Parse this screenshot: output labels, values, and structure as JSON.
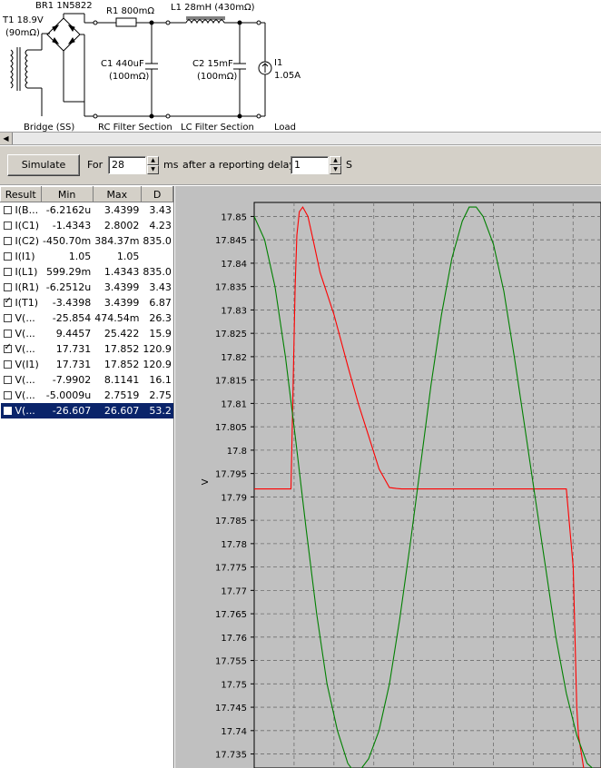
{
  "schematic": {
    "transformer": {
      "line1": "T1 18.9V",
      "line2": "(90mΩ)"
    },
    "bridge": {
      "label": "BR1 1N5822",
      "section": "Bridge (SS)"
    },
    "r1": {
      "label": "R1 800mΩ"
    },
    "l1": {
      "label": "L1 28mH (430mΩ)"
    },
    "c1": {
      "line1": "C1 440uF",
      "line2": "(100mΩ)"
    },
    "c2": {
      "line1": "C2 15mF",
      "line2": "(100mΩ)"
    },
    "i1": {
      "line1": "I1",
      "line2": "1.05A"
    },
    "sections": {
      "rc": "RC Filter Section",
      "lc": "LC Filter Section",
      "load": "Load"
    }
  },
  "scroll": {
    "left_arrow": "◀"
  },
  "toolbar": {
    "simulate_label": "Simulate",
    "for_label": "For",
    "duration_value": "28",
    "duration_unit": "ms",
    "delay_label": "after a reporting delay of",
    "delay_value": "1",
    "delay_unit": "S"
  },
  "results": {
    "columns": [
      "Result",
      "Min",
      "Max",
      "D"
    ],
    "rows": [
      {
        "name": "I(B...",
        "min": "-6.2162u",
        "max": "3.4399",
        "d": "3.43",
        "checked": false,
        "selected": false
      },
      {
        "name": "I(C1)",
        "min": "-1.4343",
        "max": "2.8002",
        "d": "4.23",
        "checked": false,
        "selected": false
      },
      {
        "name": "I(C2)",
        "min": "-450.70m",
        "max": "384.37m",
        "d": "835.0",
        "checked": false,
        "selected": false
      },
      {
        "name": "I(I1)",
        "min": "1.05",
        "max": "1.05",
        "d": "",
        "checked": false,
        "selected": false
      },
      {
        "name": "I(L1)",
        "min": "599.29m",
        "max": "1.4343",
        "d": "835.0",
        "checked": false,
        "selected": false
      },
      {
        "name": "I(R1)",
        "min": "-6.2512u",
        "max": "3.4399",
        "d": "3.43",
        "checked": false,
        "selected": false
      },
      {
        "name": "I(T1)",
        "min": "-3.4398",
        "max": "3.4399",
        "d": "6.87",
        "checked": true,
        "selected": false
      },
      {
        "name": "V(...",
        "min": "-25.854",
        "max": "474.54m",
        "d": "26.3",
        "checked": false,
        "selected": false
      },
      {
        "name": "V(...",
        "min": "9.4457",
        "max": "25.422",
        "d": "15.9",
        "checked": false,
        "selected": false
      },
      {
        "name": "V(...",
        "min": "17.731",
        "max": "17.852",
        "d": "120.9",
        "checked": true,
        "selected": false
      },
      {
        "name": "V(I1)",
        "min": "17.731",
        "max": "17.852",
        "d": "120.9",
        "checked": false,
        "selected": false
      },
      {
        "name": "V(...",
        "min": "-7.9902",
        "max": "8.1141",
        "d": "16.1",
        "checked": false,
        "selected": false
      },
      {
        "name": "V(...",
        "min": "-5.0009u",
        "max": "2.7519",
        "d": "2.75",
        "checked": false,
        "selected": false
      },
      {
        "name": "V(...",
        "min": "-26.607",
        "max": "26.607",
        "d": "53.2",
        "checked": false,
        "selected": true
      }
    ]
  },
  "chart_data": {
    "type": "line",
    "ylabel": "V",
    "ylim": [
      17.732,
      17.853
    ],
    "yticks": [
      "17.85",
      "17.845",
      "17.84",
      "17.835",
      "17.83",
      "17.825",
      "17.82",
      "17.815",
      "17.81",
      "17.805",
      "17.8",
      "17.795",
      "17.79",
      "17.785",
      "17.78",
      "17.775",
      "17.77",
      "17.765",
      "17.76",
      "17.755",
      "17.75",
      "17.745",
      "17.74",
      "17.735"
    ],
    "xlim": [
      0,
      1
    ],
    "grid": true,
    "series": [
      {
        "color": "#ff0000",
        "x": [
          0,
          0.106,
          0.118,
          0.123,
          0.13,
          0.14,
          0.155,
          0.17,
          0.19,
          0.23,
          0.27,
          0.3,
          0.33,
          0.36,
          0.39,
          0.41,
          0.425,
          0.44,
          0.88,
          0.9,
          0.92,
          0.93,
          0.935,
          0.95,
          0.97,
          1.0
        ],
        "y": [
          17.7917,
          17.7917,
          17.835,
          17.846,
          17.851,
          17.852,
          17.85,
          17.845,
          17.838,
          17.829,
          17.818,
          17.81,
          17.803,
          17.796,
          17.792,
          17.7918,
          17.7917,
          17.7917,
          17.7917,
          17.7917,
          17.775,
          17.745,
          17.739,
          17.732,
          17.731,
          17.732
        ]
      },
      {
        "color": "#008000",
        "x": [
          0,
          0.03,
          0.06,
          0.09,
          0.12,
          0.15,
          0.18,
          0.21,
          0.24,
          0.27,
          0.29,
          0.31,
          0.33,
          0.36,
          0.39,
          0.42,
          0.45,
          0.48,
          0.51,
          0.54,
          0.57,
          0.6,
          0.62,
          0.64,
          0.66,
          0.69,
          0.72,
          0.75,
          0.78,
          0.81,
          0.84,
          0.87,
          0.9,
          0.93,
          0.96,
          0.99,
          1.0
        ],
        "y": [
          17.85,
          17.845,
          17.835,
          17.82,
          17.802,
          17.783,
          17.765,
          17.75,
          17.74,
          17.733,
          17.731,
          17.732,
          17.734,
          17.74,
          17.75,
          17.764,
          17.78,
          17.797,
          17.814,
          17.829,
          17.841,
          17.849,
          17.852,
          17.852,
          17.85,
          17.844,
          17.834,
          17.82,
          17.805,
          17.79,
          17.775,
          17.76,
          17.748,
          17.739,
          17.733,
          17.731,
          17.732
        ]
      }
    ]
  }
}
